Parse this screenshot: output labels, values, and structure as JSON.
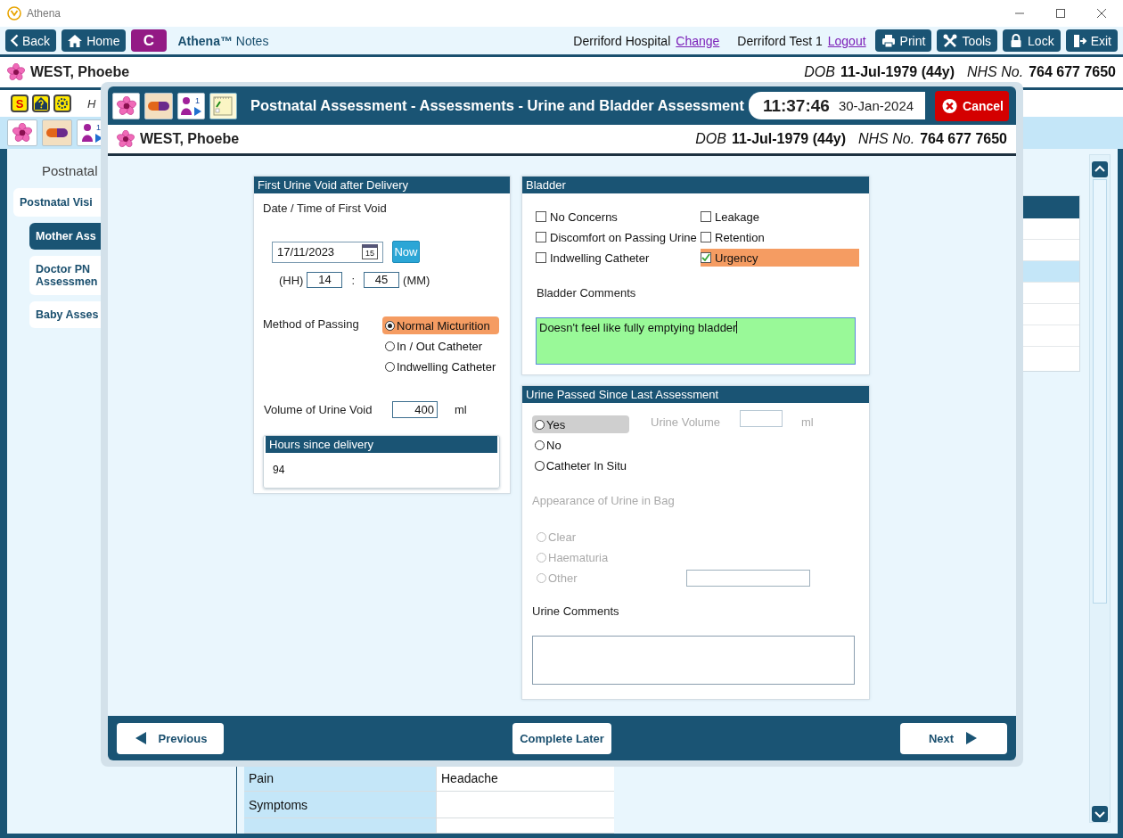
{
  "window": {
    "title": "Athena"
  },
  "toolbar": {
    "left_buttons": [
      {
        "label": "Back",
        "kind": "back"
      },
      {
        "label": "Home",
        "kind": "home"
      },
      {
        "label": "C",
        "kind": "letter"
      }
    ],
    "app_title": "**Athena™** Notes",
    "location": "Derriford Hospital",
    "location_link": "Change",
    "user": "Derriford Test 1",
    "user_link": "Logout",
    "right_buttons": [
      {
        "label": "Print",
        "kind": "print"
      },
      {
        "label": "Tools",
        "kind": "tools"
      },
      {
        "label": "Lock",
        "kind": "lock"
      },
      {
        "label": "Exit",
        "kind": "exit"
      }
    ]
  },
  "patient": {
    "name": "WEST, Phoebe",
    "dob_label": "DOB",
    "dob": "11-Jul-1979 (44y)",
    "nhs_label": "NHS No.",
    "nhs": "764 677 7650"
  },
  "alert_row": {
    "icons": [
      {
        "kind": "alert",
        "letter": "S"
      },
      {
        "kind": "help"
      },
      {
        "kind": "gear"
      }
    ],
    "text": "H"
  },
  "icon_row": [
    {
      "kind": "flower"
    },
    {
      "kind": "pill"
    },
    {
      "kind": "baby",
      "count": "1"
    }
  ],
  "nav": {
    "heading": "Postnatal",
    "items": [
      {
        "label": "Postnatal Visi",
        "selected": false,
        "children": [
          {
            "label": "Mother Ass",
            "selected": true
          },
          {
            "label": "Doctor PN Assessmen",
            "selected": false
          },
          {
            "label": "Baby Asses",
            "selected": false
          }
        ]
      }
    ]
  },
  "background_table": {
    "rows": [
      {
        "label": "Pain",
        "value": "Headache"
      },
      {
        "label": "Symptoms"
      }
    ]
  },
  "dialog": {
    "icons": [
      {
        "kind": "flower"
      },
      {
        "kind": "pill"
      },
      {
        "kind": "baby",
        "count": "1"
      },
      {
        "kind": "notes"
      }
    ],
    "title": "Postnatal Assessment - Assessments - Urine and Bladder Assessment",
    "time": "11:37:46",
    "date": "30-Jan-2024",
    "cancel": "Cancel",
    "patient": {
      "name": "WEST, Phoebe",
      "dob_label": "DOB",
      "dob": "11-Jul-1979 (44y)",
      "nhs_label": "NHS No.",
      "nhs": "764 677 7650"
    },
    "first_void": {
      "title": "First Urine Void after Delivery",
      "datetime_label": "Date / Time of First Void",
      "date": "17/11/2023",
      "calendar_day": "15",
      "now": "Now",
      "hh_label": "(HH)",
      "hour": "14",
      "separator": ":",
      "minute": "45",
      "mm_label": "(MM)",
      "method_label": "Method of Passing",
      "methods": [
        {
          "label": "Normal Micturition",
          "selected": true
        },
        {
          "label": "In / Out Catheter",
          "selected": false
        },
        {
          "label": "Indwelling Catheter",
          "selected": false
        }
      ],
      "volume_label": "Volume of Urine Void",
      "volume": "400",
      "unit": "ml",
      "hours": {
        "title": "Hours since delivery",
        "value": "94"
      }
    },
    "bladder": {
      "title": "Bladder",
      "options": [
        {
          "label": "No Concerns",
          "checked": false
        },
        {
          "label": "Leakage",
          "checked": false
        },
        {
          "label": "Discomfort on Passing Urine",
          "checked": false
        },
        {
          "label": "Retention",
          "checked": false
        },
        {
          "label": "Indwelling Catheter",
          "checked": false
        },
        {
          "label": "Urgency",
          "checked": true
        }
      ],
      "comments_label": "Bladder Comments",
      "comments": "Doesn't feel like fully emptying bladder"
    },
    "urine_passed": {
      "title": "Urine Passed Since Last Assessment",
      "options": [
        {
          "label": "Yes",
          "selected": false,
          "hovered": true
        },
        {
          "label": "No",
          "selected": false,
          "hovered": false
        },
        {
          "label": "Catheter In Situ",
          "selected": false,
          "hovered": false
        }
      ],
      "volume_label": "Urine Volume",
      "volume_unit": "ml",
      "volume_disabled": true,
      "appearance_label": "Appearance of Urine in Bag",
      "appearance_disabled": true,
      "appearance_options": [
        {
          "label": "Clear",
          "selected": false
        },
        {
          "label": "Haematuria",
          "selected": false
        },
        {
          "label": "Other",
          "selected": false
        }
      ],
      "comments_label": "Urine Comments"
    },
    "footer": {
      "previous": "Previous",
      "complete_later": "Complete Later",
      "next": "Next"
    }
  }
}
